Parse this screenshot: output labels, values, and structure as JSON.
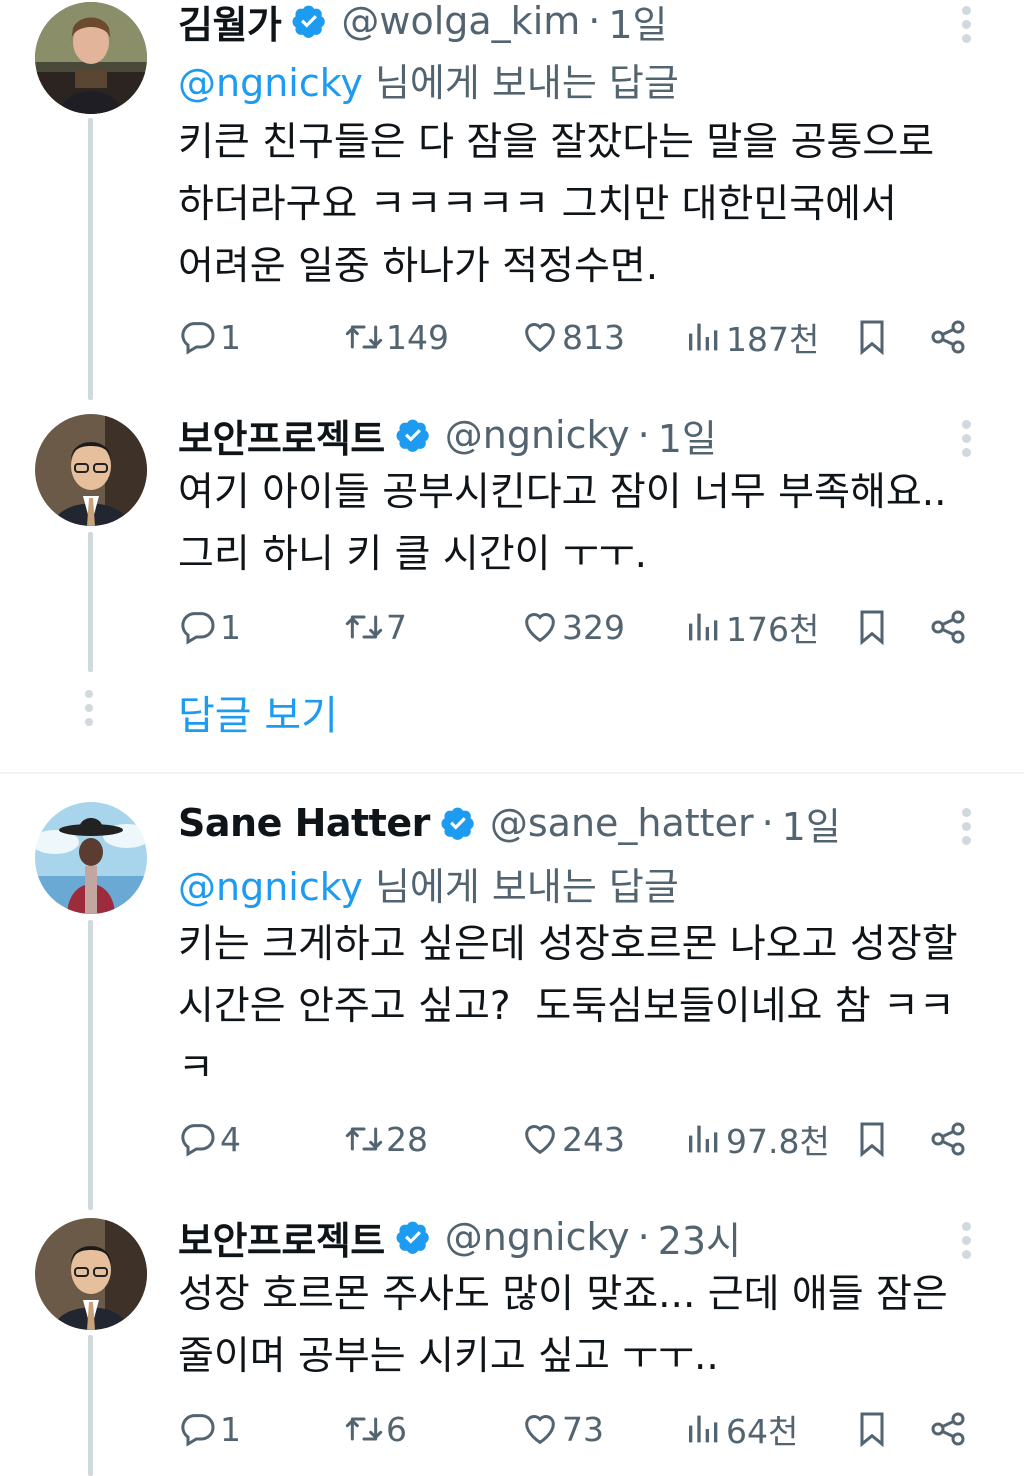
{
  "tweets": [
    {
      "name": "김월가",
      "handle": "@wolga_kim",
      "dot": "·",
      "time": "1일",
      "reply_mention": "@ngnicky",
      "reply_suffix": " 님에게 보내는 답글",
      "text": "키큰 친구들은 다 잠을 잘잤다는 말을 공통으로\n하더라구요 ㅋㅋㅋㅋㅋ 그치만 대한민국에서\n어려운 일중 하나가 적정수면.",
      "replies": "1",
      "retweets": "149",
      "likes": "813",
      "views": "187천"
    },
    {
      "name": "보안프로젝트",
      "handle": "@ngnicky",
      "dot": "·",
      "time": "1일",
      "text": "여기 아이들 공부시킨다고 잠이 너무 부족해요..\n그리 하니 키 클 시간이 ㅜㅜ.",
      "replies": "1",
      "retweets": "7",
      "likes": "329",
      "views": "176천"
    },
    {
      "name": "Sane Hatter",
      "handle": "@sane_hatter",
      "dot": "·",
      "time": "1일",
      "reply_mention": "@ngnicky",
      "reply_suffix": " 님에게 보내는 답글",
      "text": "키는 크게하고 싶은데 성장호르몬 나오고 성장할\n시간은 안주고 싶고?  도둑심보들이네요 참 ㅋㅋ\nㅋ",
      "replies": "4",
      "retweets": "28",
      "likes": "243",
      "views": "97.8천"
    },
    {
      "name": "보안프로젝트",
      "handle": "@ngnicky",
      "dot": "·",
      "time": "23시",
      "text": "성장 호르몬 주사도 많이 맞죠... 근데 애들 잠은\n줄이며 공부는 시키고 싶고 ㅜㅜ..",
      "replies": "1",
      "retweets": "6",
      "likes": "73",
      "views": "64천"
    }
  ],
  "show_replies": "답글 보기",
  "colors": {
    "accent": "#1d9bf0",
    "muted": "#536471",
    "thread": "#cfd9de"
  },
  "icons": [
    "verified-badge-icon",
    "reply-icon",
    "retweet-icon",
    "like-icon",
    "views-icon",
    "bookmark-icon",
    "share-icon",
    "more-icon"
  ]
}
